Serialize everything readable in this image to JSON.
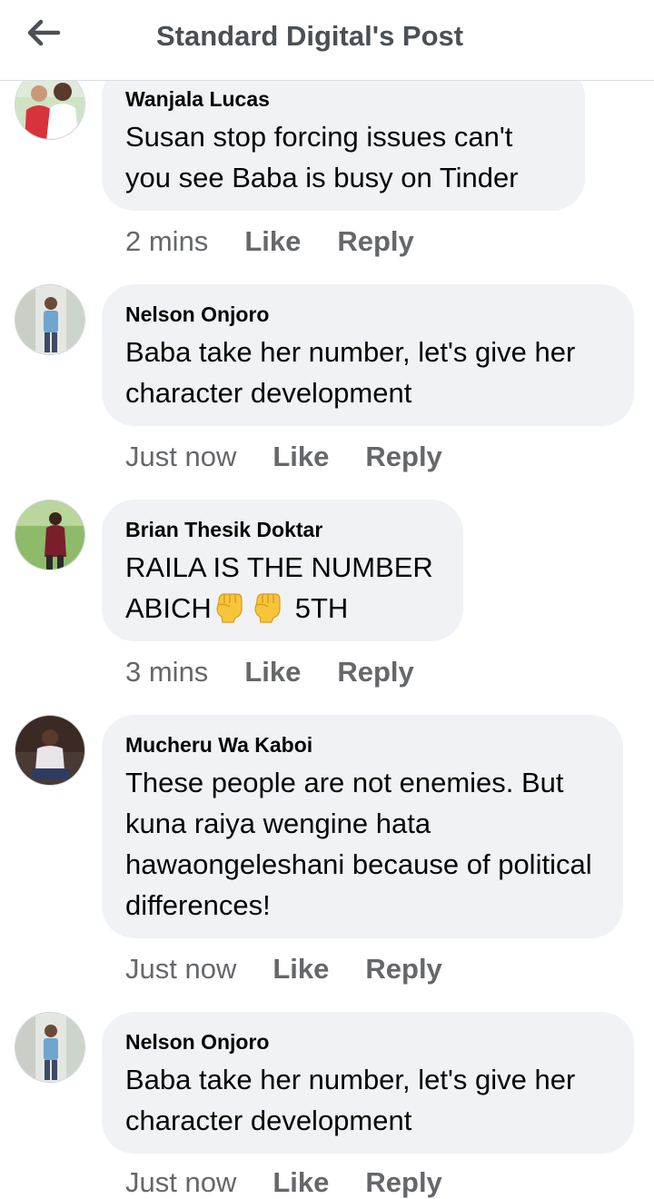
{
  "header": {
    "title": "Standard Digital's Post",
    "back_icon": "arrow-left-icon"
  },
  "comments": [
    {
      "author": "Wanjala Lucas",
      "text": "Susan stop forcing issues  can't you see Baba is busy on Tinder",
      "time": "2 mins",
      "like": "Like",
      "reply": "Reply"
    },
    {
      "author": "Nelson Onjoro",
      "text": "Baba take her number, let's give her character development",
      "time": "Just now",
      "like": "Like",
      "reply": "Reply"
    },
    {
      "author": "Brian Thesik Doktar",
      "text_before": "RAILA IS THE NUMBER ABICH",
      "emoji": "raised-fist-emoji",
      "text_after": "5TH",
      "time": "3 mins",
      "like": "Like",
      "reply": "Reply"
    },
    {
      "author": "Mucheru Wa Kaboi",
      "text": "These people are not enemies. But kuna raiya wengine hata hawaongeleshani because of political differences!",
      "time": "Just now",
      "like": "Like",
      "reply": "Reply"
    },
    {
      "author": "Nelson Onjoro",
      "text": "Baba take her number, let's give her character development",
      "time": "Just now",
      "like": "Like",
      "reply": "Reply"
    }
  ],
  "colors": {
    "bubble": "#f0f2f5",
    "secondary_text": "#65676b",
    "title": "#4b4f56"
  }
}
